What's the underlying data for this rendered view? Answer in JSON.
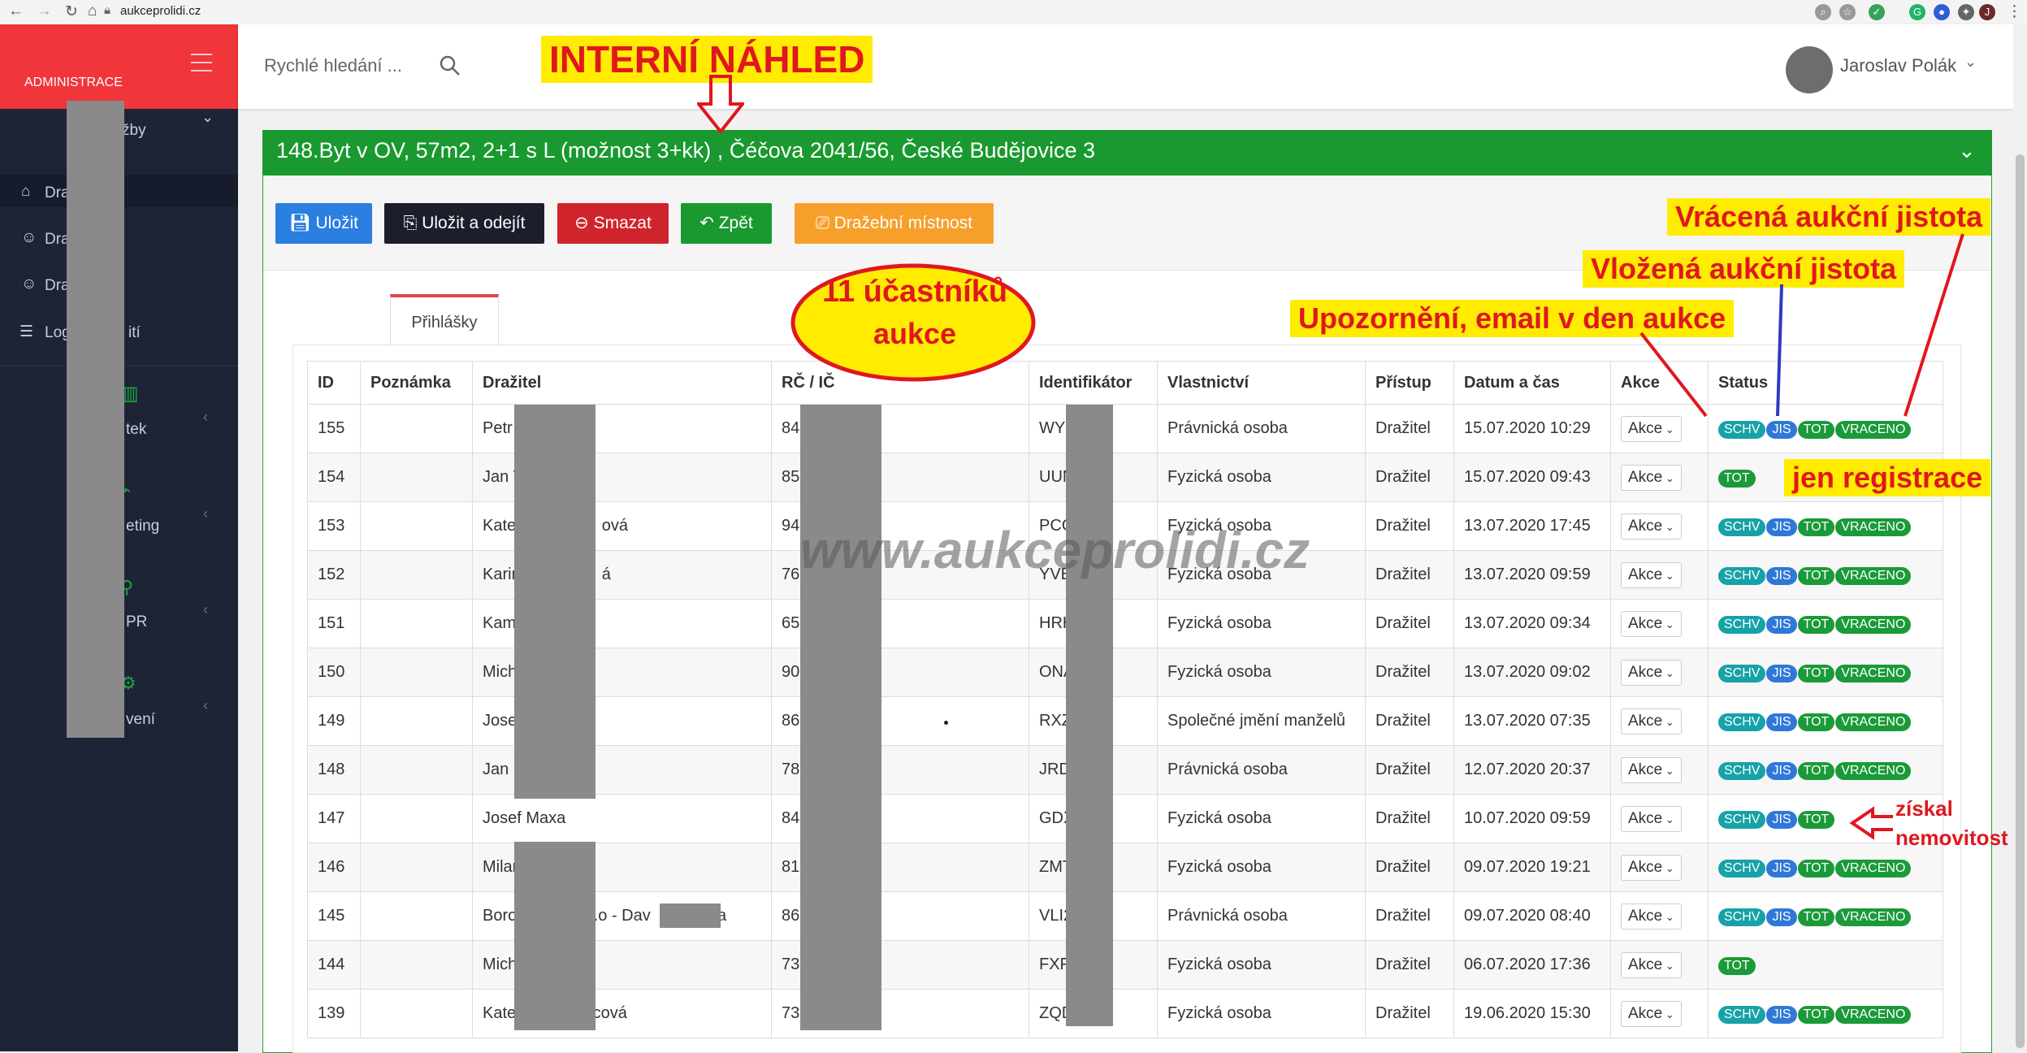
{
  "browser": {
    "url": "aukceprolidi.cz",
    "back_icon": "arrow-left",
    "forward_icon": "arrow-right",
    "reload_icon": "reload",
    "home_icon": "home"
  },
  "brand": {
    "label": "ADMINISTRACE"
  },
  "sidebar": {
    "items": [
      {
        "label": "žby",
        "icon": "chevron-down"
      },
      {
        "label": "Dra",
        "icon": "gavel"
      },
      {
        "label": "Dra",
        "icon": "users"
      },
      {
        "label": "Dra",
        "icon": "user"
      },
      {
        "label": "Log",
        "extra": "ití",
        "icon": "list"
      },
      {
        "label": "tek",
        "icon": "building"
      },
      {
        "label": "eting",
        "icon": "marketing"
      },
      {
        "label": "PR",
        "icon": "pr"
      },
      {
        "label": "vení",
        "icon": "settings"
      }
    ]
  },
  "topbar": {
    "search_placeholder": "Rychlé hledání ...",
    "user_name": "Jaroslav Polák"
  },
  "panel": {
    "title": "148.Byt v OV, 57m2, 2+1 s L (možnost 3+kk) , Čéčova 2041/56, České Budějovice 3"
  },
  "toolbar": {
    "save": "Uložit",
    "save_exit": "Uložit a odejít",
    "delete": "Smazat",
    "back": "Zpět",
    "auction_room": "Dražební místnost"
  },
  "tab": {
    "label": "Přihlášky"
  },
  "table": {
    "headers": [
      "ID",
      "Poznámka",
      "Dražitel",
      "RČ / IČ",
      "Identifikátor",
      "Vlastnictví",
      "Přístup",
      "Datum a čas",
      "Akce",
      "Status"
    ],
    "rows": [
      {
        "id": "155",
        "note": "",
        "bidder": "Petr",
        "rc": "840",
        "ident": "WYK",
        "own": "Právnická osoba",
        "access": "Dražitel",
        "date": "15.07.2020 10:29",
        "akce": "Akce",
        "status": [
          "SCHV",
          "JIS",
          "TOT",
          "VRACENO"
        ]
      },
      {
        "id": "154",
        "note": "",
        "bidder": "Jan V",
        "rc": "850",
        "ident": "UUN",
        "own": "Fyzická osoba",
        "access": "Dražitel",
        "date": "15.07.2020 09:43",
        "akce": "Akce",
        "status": [
          "TOT"
        ]
      },
      {
        "id": "153",
        "note": "",
        "bidder": "Kate                   ová",
        "rc": "940",
        "ident": "PCG",
        "own": "Fyzická osoba",
        "access": "Dražitel",
        "date": "13.07.2020 17:45",
        "akce": "Akce",
        "status": [
          "SCHV",
          "JIS",
          "TOT",
          "VRACENO"
        ]
      },
      {
        "id": "152",
        "note": "",
        "bidder": "Karin                  á",
        "rc": "760",
        "ident": "YVB",
        "own": "Fyzická osoba",
        "access": "Dražitel",
        "date": "13.07.2020 09:59",
        "akce": "Akce",
        "status": [
          "SCHV",
          "JIS",
          "TOT",
          "VRACENO"
        ]
      },
      {
        "id": "151",
        "note": "",
        "bidder": "Kam",
        "rc": "651",
        "ident": "HRH",
        "own": "Fyzická osoba",
        "access": "Dražitel",
        "date": "13.07.2020 09:34",
        "akce": "Akce",
        "status": [
          "SCHV",
          "JIS",
          "TOT",
          "VRACENO"
        ]
      },
      {
        "id": "150",
        "note": "",
        "bidder": "Mich",
        "rc": "900",
        "ident": "ONA",
        "own": "Fyzická osoba",
        "access": "Dražitel",
        "date": "13.07.2020 09:02",
        "akce": "Akce",
        "status": [
          "SCHV",
          "JIS",
          "TOT",
          "VRACENO"
        ]
      },
      {
        "id": "149",
        "note": "",
        "bidder": "Jose",
        "rc": "860",
        "ident": "RXZ",
        "own": "Společné jmění manželů",
        "access": "Dražitel",
        "date": "13.07.2020 07:35",
        "akce": "Akce",
        "status": [
          "SCHV",
          "JIS",
          "TOT",
          "VRACENO"
        ]
      },
      {
        "id": "148",
        "note": "",
        "bidder": "Jan D",
        "rc": "781",
        "ident": "JRD",
        "own": "Právnická osoba",
        "access": "Dražitel",
        "date": "12.07.2020 20:37",
        "akce": "Akce",
        "status": [
          "SCHV",
          "JIS",
          "TOT",
          "VRACENO"
        ]
      },
      {
        "id": "147",
        "note": "",
        "bidder": "Josef Maxa",
        "rc": "840",
        "ident": "GDX",
        "own": "Fyzická osoba",
        "access": "Dražitel",
        "date": "10.07.2020 09:59",
        "akce": "Akce",
        "status": [
          "SCHV",
          "JIS",
          "TOT"
        ]
      },
      {
        "id": "146",
        "note": "",
        "bidder": "Milan",
        "rc": "810",
        "ident": "ZMT",
        "own": "Fyzická osoba",
        "access": "Dražitel",
        "date": "09.07.2020 19:21",
        "akce": "Akce",
        "status": [
          "SCHV",
          "JIS",
          "TOT",
          "VRACENO"
        ]
      },
      {
        "id": "145",
        "note": "",
        "bidder": "Boro               .r.o - Dav             ka",
        "rc": "861",
        "ident": "VLI2",
        "own": "Právnická osoba",
        "access": "Dražitel",
        "date": "09.07.2020 08:40",
        "akce": "Akce",
        "status": [
          "SCHV",
          "JIS",
          "TOT",
          "VRACENO"
        ]
      },
      {
        "id": "144",
        "note": "",
        "bidder": "Mich               e",
        "rc": "730",
        "ident": "FXF",
        "own": "Fyzická osoba",
        "access": "Dražitel",
        "date": "06.07.2020 17:36",
        "akce": "Akce",
        "status": [
          "TOT"
        ]
      },
      {
        "id": "139",
        "note": "",
        "bidder": "Kate               ncová",
        "rc": "730",
        "ident": "ZQD",
        "own": "Fyzická osoba",
        "access": "Dražitel",
        "date": "19.06.2020 15:30",
        "akce": "Akce",
        "status": [
          "SCHV",
          "JIS",
          "TOT",
          "VRACENO"
        ]
      }
    ]
  },
  "annotations": {
    "internal": "INTERNÍ NÁHLED",
    "participants_line1": "11 účastníků",
    "participants_line2": "aukce",
    "returned": "Vrácená aukční jistota",
    "deposited": "Vložená aukční jistota",
    "notice": "Upozornění, email v den aukce",
    "registration_only": "jen registrace",
    "won_line1": "získal",
    "won_line2": "nemovitost",
    "watermark": "www.aukceprolidi.cz"
  },
  "colors": {
    "brand_red": "#f0353b",
    "panel_green": "#19992f",
    "sidebar_dark": "#1d2436",
    "badge_schv": "#17a2a8",
    "badge_jis": "#2f78d8",
    "badge_tot": "#1a9a39"
  }
}
